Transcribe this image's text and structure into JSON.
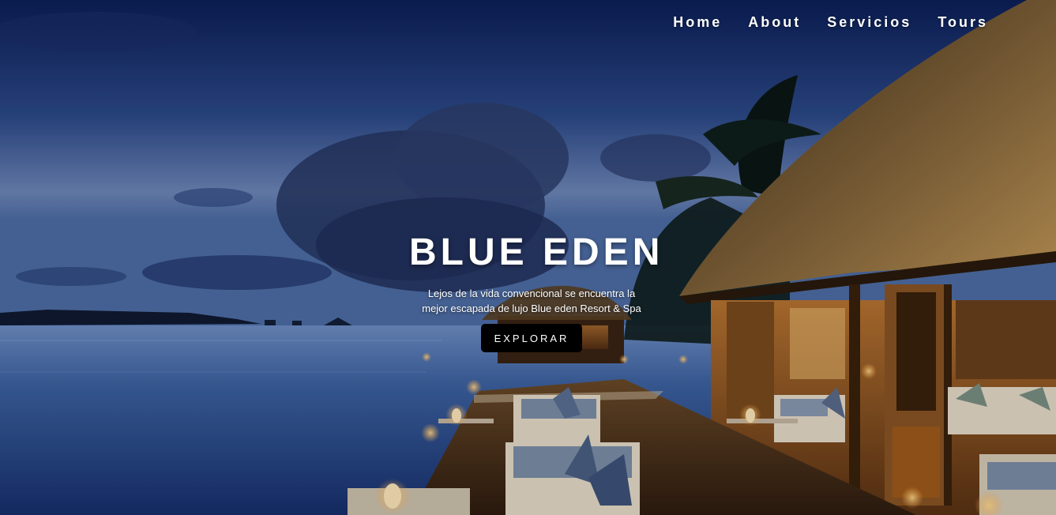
{
  "nav": {
    "items": [
      {
        "label": "Home"
      },
      {
        "label": "About"
      },
      {
        "label": "Servicios"
      },
      {
        "label": "Tours"
      }
    ]
  },
  "hero": {
    "title": "BLUE EDEN",
    "subtitle": "Lejos de la vida convencional se encuentra la mejor escapada de lujo Blue eden Resort & Spa",
    "cta_label": "EXPLORAR"
  },
  "colors": {
    "sky_top": "#0d2058",
    "sea": "#1d3f7a",
    "button_bg": "#000000",
    "text": "#ffffff",
    "warm_light": "#e8a04a"
  }
}
